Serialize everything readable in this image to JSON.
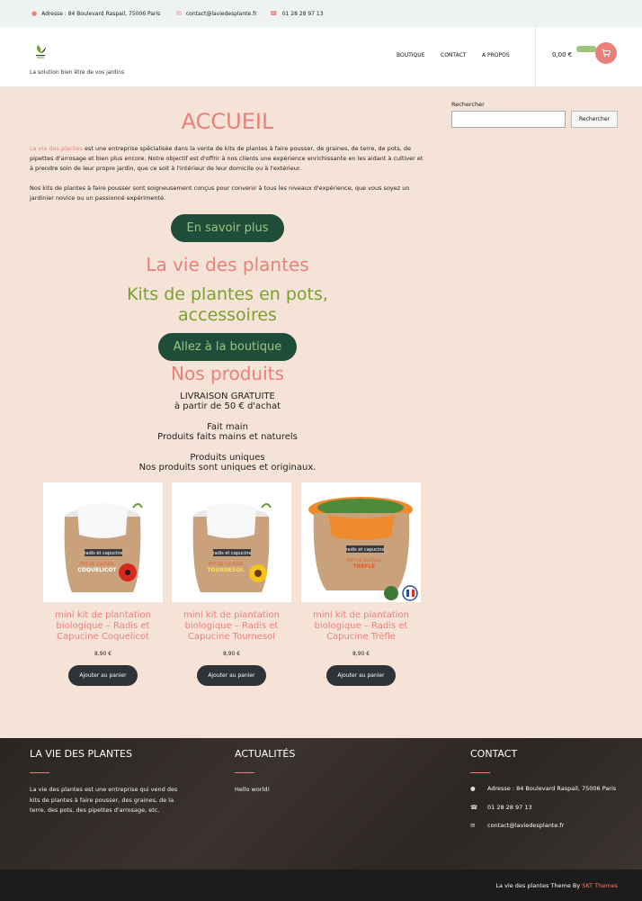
{
  "topbar": {
    "address": "Adresse : 84 Boulevard Raspail, 75006 Paris",
    "email": "contact@laviedesplante.fr",
    "phone": "01 28 28 97 13"
  },
  "header": {
    "tagline": "La solution bien être de vos jardins",
    "nav": [
      "BOUTIQUE",
      "CONTACT",
      "A PROPOS"
    ],
    "cart_total": "0,00 €"
  },
  "main": {
    "title": "ACCUEIL",
    "intro_brand": "La vie des plantes",
    "intro_rest": " est une entreprise spécialisée dans la vente de kits de plantes à faire pousser, de graines, de terre, de pots, de pipettes d'arrosage et bien plus encore. Notre objectif est d'offrir à nos clients une expérience enrichissante en les aidant à cultiver et à prendre soin de leur propre jardin, que ce soit à l'intérieur de leur domicile ou à l'extérieur.",
    "para2": "Nos kits de plantes à faire pousser sont soigneusement conçus pour convenir à tous les niveaux d'expérience, que vous soyez un jardinier novice ou un passionné expérimenté.",
    "btn_more": "En savoir plus",
    "brand_heading": "La vie des plantes",
    "kits_line1": "Kits de plantes en pots,",
    "kits_line2": "accessoires",
    "btn_shop": "Allez à la boutique",
    "products_heading": "Nos produits",
    "feature1_title": "LIVRAISON GRATUITE",
    "feature1_text": "à partir de 50 € d'achat",
    "feature2_title": "Fait main",
    "feature2_text": "Produits faits mains et naturels",
    "feature3_title": "Produits uniques",
    "feature3_text": "Nos produits sont uniques et originaux."
  },
  "products": [
    {
      "name": "mini kit de plantation biologique – Radis et Capucine Coquelicot",
      "label": "COQUELICOT",
      "price": "8,90 €",
      "button": "Ajouter au panier"
    },
    {
      "name": "mini kit de plantation biologique – Radis et Capucine Tournesol",
      "label": "TOURNESOL",
      "price": "8,90 €",
      "button": "Ajouter au panier"
    },
    {
      "name": "mini kit de plantation biologique – Radis et Capucine Trèfle",
      "label": "TRÈFLE",
      "price": "8,90 €",
      "button": "Ajouter au panier"
    }
  ],
  "product_brand": "radis et capucine",
  "product_subtitle": "POT DE CULTURE",
  "sidebar": {
    "search_label": "Rechercher",
    "search_value": "",
    "search_button": "Rechercher"
  },
  "footer": {
    "col1_title": "LA VIE DES PLANTES",
    "col1_text": "La vie des plantes est une entreprise qui vend des kits de plantes à faire pousser, des graines, de la terre, des pots, des pipettes d'arrosage, etc.",
    "col2_title": "ACTUALITÉS",
    "col2_link": "Hello world!",
    "col3_title": "CONTACT",
    "col3_address": "Adresse : 84 Boulevard Raspail, 75006 Paris",
    "col3_phone": "01 28 28 97 13",
    "col3_email": "contact@laviedesplante.fr",
    "credit_text": "La vie des plantes Theme By ",
    "credit_link": "SKT Themes"
  },
  "colors": {
    "accent": "#e9807a",
    "green_dark": "#1f4d3a",
    "green_light": "#9cc57c",
    "page_bg": "#f6e3d8"
  }
}
